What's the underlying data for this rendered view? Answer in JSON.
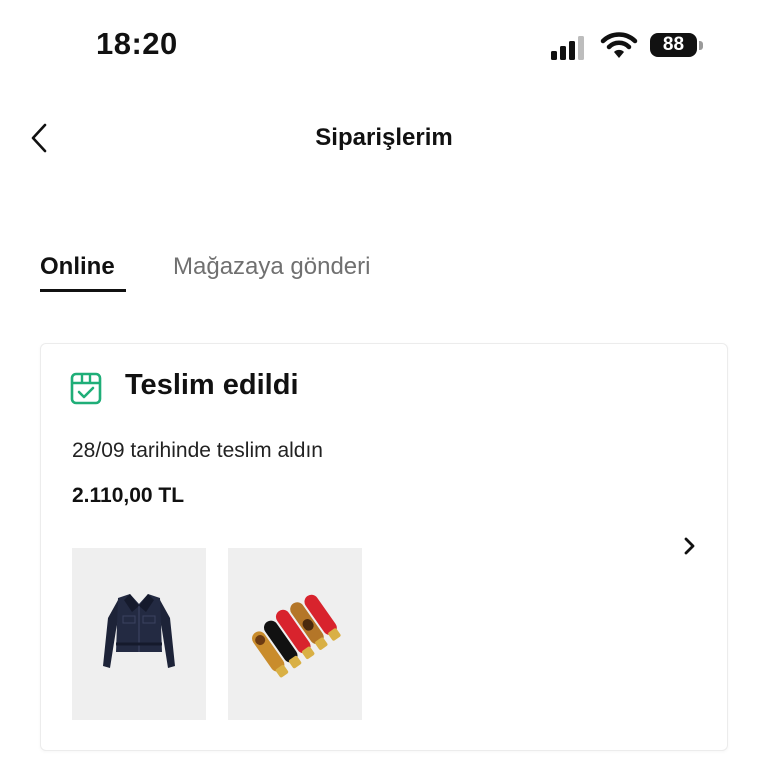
{
  "status_bar": {
    "time": "18:20",
    "battery_level": "88",
    "signal_bars_active": 3,
    "icons": [
      "cellular-signal-icon",
      "wifi-icon",
      "battery-icon"
    ]
  },
  "header": {
    "title": "Siparişlerim",
    "back_icon": "chevron-left-icon"
  },
  "tabs": [
    {
      "label": "Online",
      "selected": true
    },
    {
      "label": "Mağazaya gönderi",
      "selected": false
    }
  ],
  "order": {
    "status_icon": "package-check-icon",
    "status": "Teslim edildi",
    "delivery_text": "28/09 tarihinde teslim aldın",
    "total": "2.110,00 TL",
    "open_icon": "chevron-right-icon",
    "products": [
      {
        "image": "denim-jacket"
      },
      {
        "image": "multicolor-hair-clips"
      }
    ]
  },
  "colors": {
    "accent_green": "#1fae78",
    "text_primary": "#111111",
    "text_secondary": "#707070",
    "thumb_background": "#efefef"
  }
}
